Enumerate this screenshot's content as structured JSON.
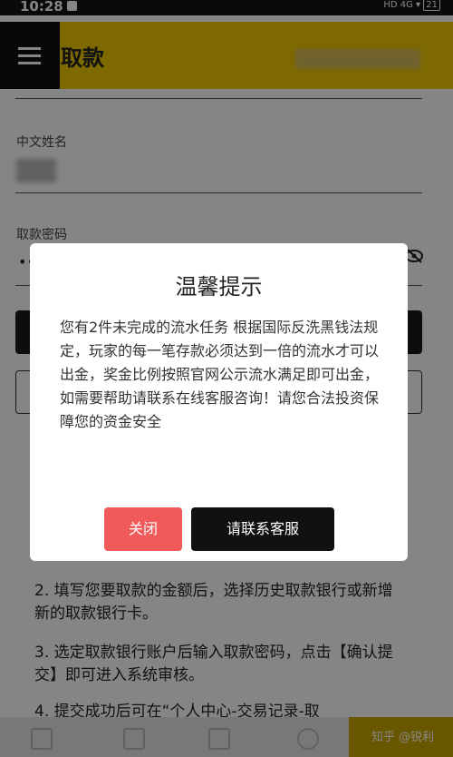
{
  "status_bar": {
    "time": "10:28",
    "indicators": "HD 4G",
    "battery": "21"
  },
  "header": {
    "title": "取款"
  },
  "form": {
    "name_label": "中文姓名",
    "password_label": "取款密码",
    "password_value": "••"
  },
  "instructions": {
    "step2": "2. 填写您要取款的金额后，选择历史取款银行或新增新的取款银行卡。",
    "step3": "3. 选定取款银行账户后输入取款密码，点击【确认提交】即可进入系统审核。",
    "step4": "4. 提交成功后可在“个人中心-交易记录-取"
  },
  "dialog": {
    "title": "温馨提示",
    "message": "您有2件未完成的流水任务 根据国际反洗黑钱法规定，玩家的每一笔存款必须达到一倍的流水才可以出金，奖金比例按照官网公示流水满足即可出金，如需要帮助请联系在线客服咨询！请您合法投资保障您的资金安全",
    "close_label": "关闭",
    "service_label": "请联系客服"
  },
  "watermark": "知乎 @锐利",
  "colors": {
    "header_yellow": "#f0c900",
    "close_red": "#f05a5a",
    "overlay": "rgba(0,0,0,0.48)"
  }
}
